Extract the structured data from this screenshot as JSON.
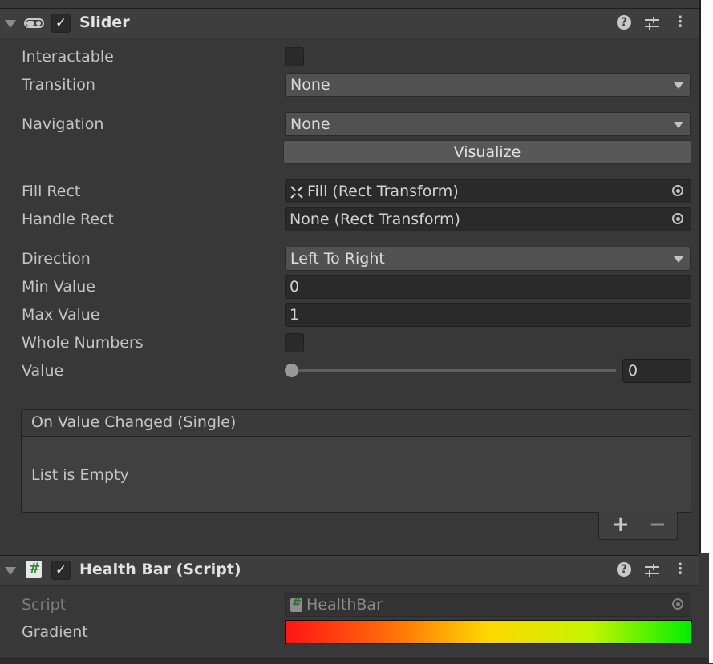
{
  "slider_component": {
    "title": "Slider",
    "enabled_check": "✓",
    "menu_icon": "⋮"
  },
  "fields": {
    "interactable": {
      "label": "Interactable",
      "checked": false
    },
    "transition": {
      "label": "Transition",
      "value": "None"
    },
    "navigation": {
      "label": "Navigation",
      "value": "None"
    },
    "visualize_button": "Visualize",
    "fill_rect": {
      "label": "Fill Rect",
      "value": "Fill (Rect Transform)"
    },
    "handle_rect": {
      "label": "Handle Rect",
      "value": "None (Rect Transform)"
    },
    "direction": {
      "label": "Direction",
      "value": "Left To Right"
    },
    "min_value": {
      "label": "Min Value",
      "value": "0"
    },
    "max_value": {
      "label": "Max Value",
      "value": "1"
    },
    "whole_numbers": {
      "label": "Whole Numbers",
      "checked": false
    },
    "value": {
      "label": "Value",
      "value": "0",
      "fraction": 0
    }
  },
  "event": {
    "title": "On Value Changed (Single)",
    "empty_text": "List is Empty",
    "add": "+",
    "remove": "−"
  },
  "healthbar_component": {
    "title": "Health Bar (Script)",
    "enabled_check": "✓",
    "script_label": "Script",
    "script_value": "HealthBar",
    "gradient_label": "Gradient",
    "hash_icon": "#"
  },
  "colors": {
    "gradient": [
      "#ff1414",
      "#ff6a0a",
      "#ffd700",
      "#c6f500",
      "#00ef00"
    ]
  }
}
